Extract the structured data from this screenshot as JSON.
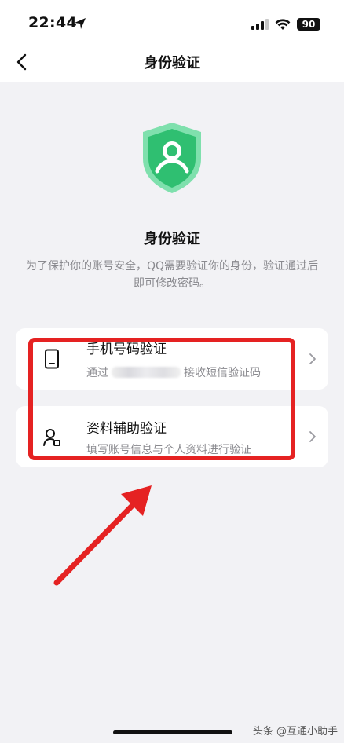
{
  "status_bar": {
    "time": "22:44",
    "battery": "90"
  },
  "nav": {
    "title": "身份验证"
  },
  "header": {
    "title": "身份验证",
    "description": "为了保护你的账号安全，QQ需要验证你的身份，验证通过后即可修改密码。"
  },
  "options": [
    {
      "title": "手机号码验证",
      "subtitle_prefix": "通过",
      "subtitle_suffix": "接收短信验证码",
      "icon": "phone-icon"
    },
    {
      "title": "资料辅助验证",
      "subtitle": "填写账号信息与个人资料进行验证",
      "icon": "user-profile-icon"
    }
  ],
  "watermark": "头条 @互通小助手",
  "colors": {
    "accent_green": "#2fbf71",
    "highlight_red": "#e52222",
    "background": "#f2f2f5"
  }
}
